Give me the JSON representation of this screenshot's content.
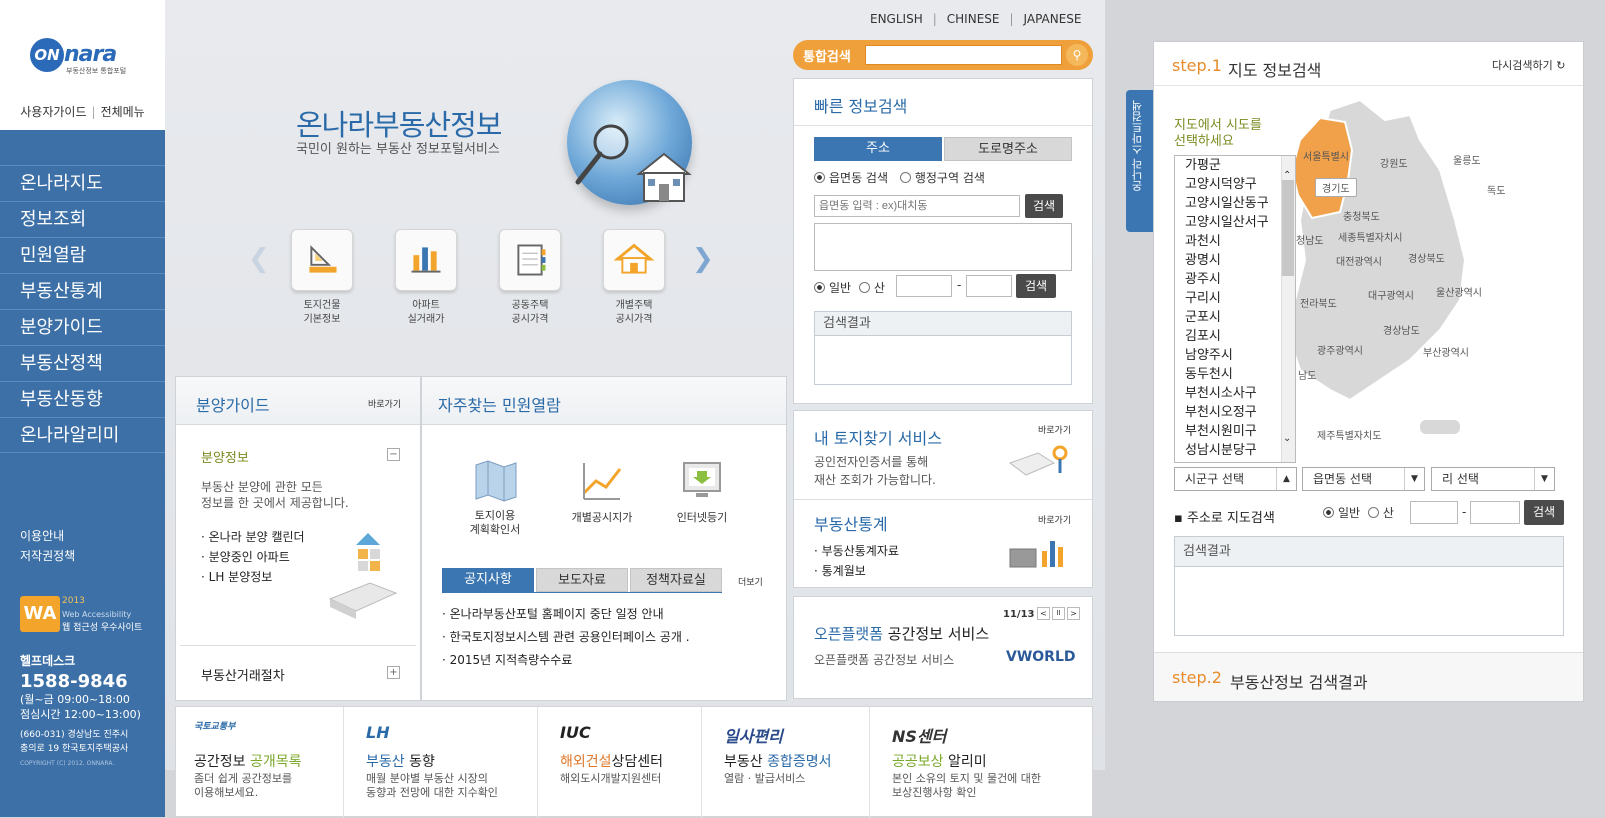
{
  "brand": {
    "logo_text": "nara",
    "logo_circle": "ON",
    "logo_sub": "부동산정보 통합포털"
  },
  "top_nav": {
    "guide": "사용자가이드",
    "all_menu": "전체메뉴"
  },
  "sidebar": {
    "items": [
      {
        "label": "온나라지도"
      },
      {
        "label": "정보조회"
      },
      {
        "label": "민원열람"
      },
      {
        "label": "부동산통계"
      },
      {
        "label": "분양가이드"
      },
      {
        "label": "부동산정책"
      },
      {
        "label": "부동산동향"
      },
      {
        "label": "온나라알리미"
      }
    ],
    "links": {
      "usage": "이용안내",
      "copyright": "저작권정책"
    },
    "wa": {
      "mark": "WA",
      "year": "2013",
      "line1": "Web Accessibility",
      "line2": "웹 접근성 우수사이트"
    },
    "help": {
      "title": "헬프데스크",
      "tel": "1588-9846",
      "hours1": "(월~금 09:00~18:00",
      "hours2": "점심시간 12:00~13:00)",
      "addr1": "(660-031) 경상남도 진주시",
      "addr2": "충의로 19 한국토지주택공사",
      "copy": "COPYRIGHT (C) 2012. ONNARA."
    }
  },
  "languages": {
    "en": "ENGLISH",
    "cn": "CHINESE",
    "jp": "JAPANESE"
  },
  "hero": {
    "title": "온나라부동산정보",
    "subtitle": "국민이 원하는 부동산 정보포털서비스"
  },
  "quick_icons": [
    {
      "label1": "토지건물",
      "label2": "기본정보"
    },
    {
      "label1": "아파트",
      "label2": "실거래가"
    },
    {
      "label1": "공동주택",
      "label2": "공시가격"
    },
    {
      "label1": "개별주택",
      "label2": "공시가격"
    }
  ],
  "search": {
    "label": "통합검색",
    "placeholder": ""
  },
  "quick_search": {
    "title": "빠른 정보검색",
    "tab_addr": "주소",
    "tab_road": "도로명주소",
    "radio1": "읍면동 검색",
    "radio2": "행정구역 검색",
    "input_placeholder": "읍면동 입력 : ex)대치동",
    "btn_search": "검색",
    "radio_general": "일반",
    "radio_mountain": "산",
    "dash": "-",
    "btn_search2": "검색",
    "result_label": "검색결과"
  },
  "sale_guide": {
    "title": "분양가이드",
    "goto": "바로가기",
    "sub_title": "분양정보",
    "desc1": "부동산 분양에 관한 모든",
    "desc2": "정보를 한 곳에서 제공합니다.",
    "items": [
      "온나라 분양 캘린더",
      "분양중인 아파트",
      "LH 분양정보"
    ],
    "collapse": "−",
    "other": "부동산거래절차",
    "expand": "+"
  },
  "civil": {
    "title": "자주찾는 민원열람",
    "icons": [
      {
        "label1": "토지이용",
        "label2": "계획확인서"
      },
      {
        "label1": "개별공시지가",
        "label2": ""
      },
      {
        "label1": "인터넷등기",
        "label2": ""
      }
    ],
    "tabs": [
      "공지사항",
      "보도자료",
      "정책자료실"
    ],
    "more": "더보기",
    "notices": [
      "온나라부동산포털 홈페이지 중단 일정 안내",
      "한국토지정보시스템 관련 공용인터페이스 공개 .",
      "2015년 지적측량수수료"
    ]
  },
  "my_land": {
    "title": "내 토지찾기 서비스",
    "goto": "바로가기",
    "desc1": "공인전자인증서를 통해",
    "desc2": "재산 조회가 가능합니다."
  },
  "stats": {
    "title": "부동산통계",
    "goto": "바로가기",
    "items": [
      "부동산통계자료",
      "통계월보"
    ]
  },
  "open_platform": {
    "title_accent": "오픈플랫폼",
    "title_rest": " 공간정보 서비스",
    "desc": "오픈플랫폼 공간정보 서비스",
    "counter": "11/13",
    "logo": "VWORLD",
    "prev": "<",
    "pause": "II",
    "next": ">"
  },
  "bottom_links": [
    {
      "logo": "국토교통부",
      "title_a": "공간정보 ",
      "title_b": "공개목록",
      "d1": "좀더 쉽게 공간정보를",
      "d2": "이용해보세요.",
      "color": "#222"
    },
    {
      "logo": "LH",
      "title_a": "부동산",
      "title_b": " 동향",
      "d1": "매월 분야별 부동산 시장의",
      "d2": "동향과 전망에 대한 지수확인",
      "color": "#2a6aa8"
    },
    {
      "logo": "IUC",
      "title_a": "해외건설",
      "title_b": "상담센터",
      "d1": "해외도시개발지원센터",
      "d2": "",
      "color": "#e0782a"
    },
    {
      "logo": "일사편리",
      "title_a": "부동산 ",
      "title_b": "종합증명서",
      "d1": "열람 · 발급서비스",
      "d2": "",
      "color": "#2a6aa8"
    },
    {
      "logo": "NS센터",
      "title_a": "공공보상",
      "title_b": " 알리미",
      "d1": "본인 소유의 토지 및 물건에 대한",
      "d2": "보상진행사항 확인",
      "color": "#7aa82a"
    }
  ],
  "map_panel": {
    "side_tab": "온나라 스마트검색",
    "step1": "step.1",
    "step1_name": "지도 정보검색",
    "reset": "다시검색하기",
    "hint1": "지도에서 시도를",
    "hint2": "선택하세요",
    "list": [
      "가평군",
      "고양시덕양구",
      "고양시일산동구",
      "고양시일산서구",
      "과천시",
      "광명시",
      "광주시",
      "구리시",
      "군포시",
      "김포시",
      "남양주시",
      "동두천시",
      "부천시소사구",
      "부천시오정구",
      "부천시원미구",
      "성남시분당구"
    ],
    "regions": [
      "서울특별시",
      "경기도",
      "강원도",
      "울릉도",
      "독도",
      "충청북도",
      "세종특별자치시",
      "대전광역시",
      "경상북도",
      "전라북도",
      "대구광역시",
      "울산광역시",
      "경상남도",
      "광주광역시",
      "부산광역시",
      "제주특별자치도",
      "청남도",
      "남도"
    ],
    "select1": "시군구 선택",
    "select2": "읍면동 선택",
    "select3": "리 선택",
    "addr_search": "주소로 지도검색",
    "radio_general": "일반",
    "radio_mountain": "산",
    "dash": "-",
    "btn_search": "검색",
    "result_label": "검색결과",
    "step2": "step.2",
    "step2_name": "부동산정보 검색결과"
  },
  "colors": {
    "accent_blue": "#3b76b2",
    "accent_orange": "#f0a03a",
    "sidebar": "#3d70a6"
  }
}
